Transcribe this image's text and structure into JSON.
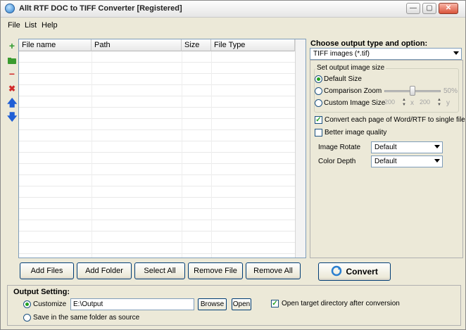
{
  "window": {
    "title": "Allt RTF DOC to TIFF Converter [Registered]",
    "controls": [
      "—",
      "▢",
      "✕"
    ]
  },
  "menu": [
    "File",
    "List",
    "Help"
  ],
  "file_list": {
    "columns": [
      "File name",
      "Path",
      "Size",
      "File Type"
    ]
  },
  "buttons": {
    "add_files": "Add Files",
    "add_folder": "Add Folder",
    "select_all": "Select All",
    "remove_file": "Remove File",
    "remove_all": "Remove All",
    "convert": "Convert"
  },
  "output_type": {
    "title": "Choose output type and option:",
    "selected": "TIFF images (*.tif)"
  },
  "image_size": {
    "group_label": "Set output image size",
    "default_size": "Default Size",
    "comparison_zoom": "Comparison Zoom",
    "zoom_value": "50%",
    "custom_size": "Custom Image Size",
    "width": "200",
    "x_sep": "x",
    "height": "200",
    "y_label": "y"
  },
  "options": {
    "convert_each_page": "Convert each page of Word/RTF to single file",
    "better_quality": "Better image quality",
    "rotate_label": "Image Rotate",
    "rotate_value": "Default",
    "depth_label": "Color Depth",
    "depth_value": "Default"
  },
  "output_setting": {
    "title": "Output Setting:",
    "customize": "Customize",
    "path": "E:\\Output",
    "browse": "Browse",
    "open": "Open",
    "open_target": "Open target directory after conversion",
    "same_folder": "Save in the same folder as source"
  },
  "colors": {
    "accent": "#21a121",
    "title_bar": "#e6e6e6",
    "face": "#ece9d8"
  }
}
